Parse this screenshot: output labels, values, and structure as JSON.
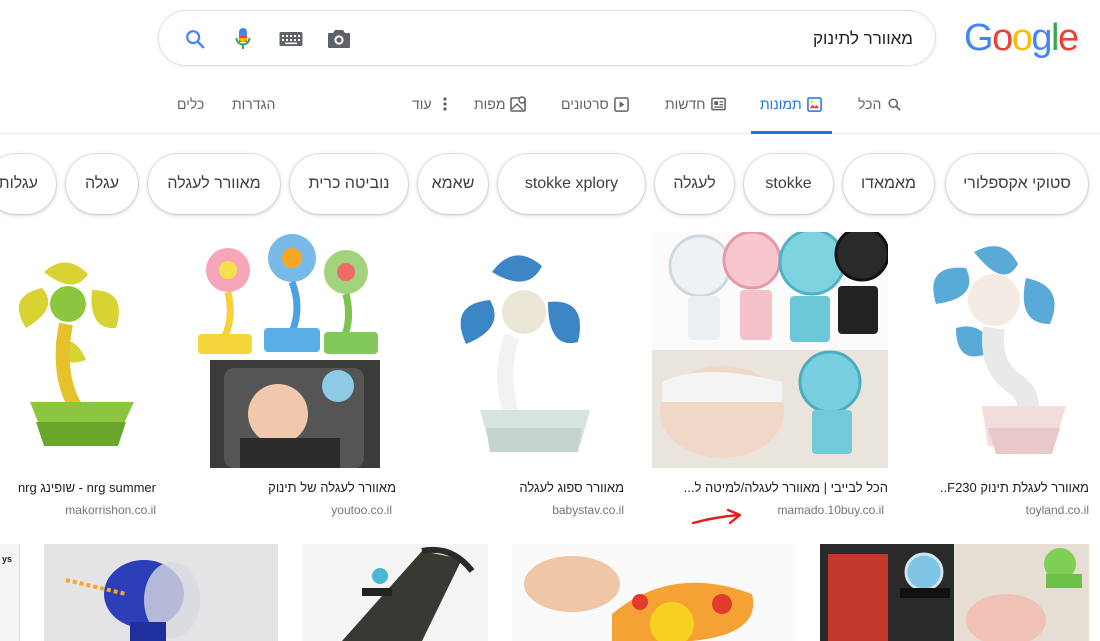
{
  "search": {
    "query": "מאוורר לתינוק",
    "icons": [
      "search-icon",
      "mic-icon",
      "keyboard-icon",
      "camera-icon"
    ]
  },
  "logo_letters": [
    "G",
    "o",
    "o",
    "g",
    "l",
    "e"
  ],
  "tabs": [
    {
      "label": "הכל",
      "icon": "search-icon"
    },
    {
      "label": "תמונות",
      "icon": "image-icon",
      "active": true
    },
    {
      "label": "חדשות",
      "icon": "news-icon"
    },
    {
      "label": "סרטונים",
      "icon": "video-icon"
    },
    {
      "label": "מפות",
      "icon": "map-icon"
    },
    {
      "label": "עוד",
      "icon": "more-vert-icon"
    },
    {
      "label": "הגדרות"
    },
    {
      "label": "כלים"
    }
  ],
  "chips": [
    "סטוקי אקספלורי",
    "מאמאדו",
    "stokke",
    "לעגלה",
    "stokke xplory",
    "שאמא",
    "נוביטה כרית",
    "מאוורר לעגלה",
    "עגלה",
    "עגלות"
  ],
  "results_row1": [
    {
      "caption": "מאוורר לעגלת תינוק F230..",
      "source": "toyland.co.il"
    },
    {
      "caption": "הכל לבייבי | מאוורר לעגלה/למיטה ל...",
      "source": "mamado.10buy.co.il"
    },
    {
      "caption": "מאוורר ספוג לעגלה",
      "source": "babystav.co.il"
    },
    {
      "caption": "מאוורר לעגלה של תינוק",
      "source": "youtoo.co.il"
    },
    {
      "caption": "nrg summer - שופינג nrg",
      "source": "makorrishon.co.il"
    }
  ],
  "results_row2_partial_text": "ys",
  "colors": {
    "accent_blue": "#1a73e8",
    "annotation_red": "#e02020"
  }
}
